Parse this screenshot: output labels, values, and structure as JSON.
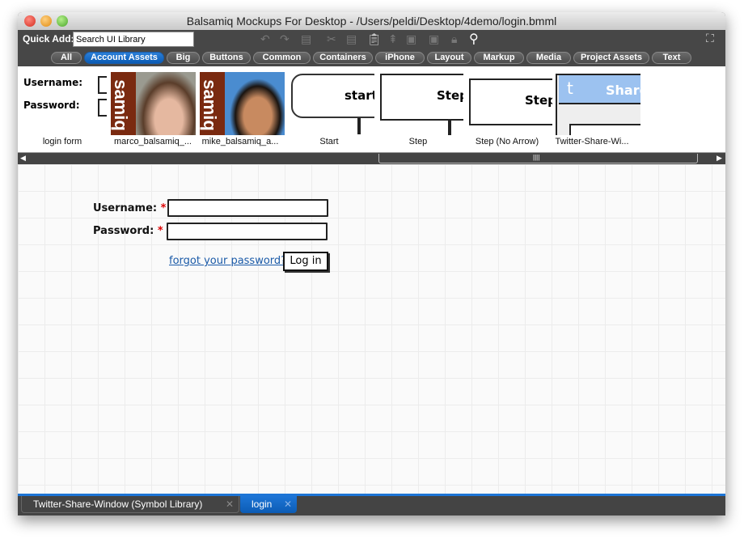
{
  "window": {
    "title": "Balsamiq Mockups For Desktop - /Users/peldi/Desktop/4demo/login.bmml"
  },
  "toolbar": {
    "quick_add_label": "Quick Add:",
    "search_value": "Search UI Library",
    "icons": [
      "undo-icon",
      "redo-icon",
      "duplicate-icon",
      "cut-icon",
      "copy-icon",
      "paste-icon",
      "group-icon",
      "bring-forward-icon",
      "send-backward-icon",
      "lock-icon",
      "search-icon"
    ],
    "fullscreen_icon": "fullscreen-icon"
  },
  "filters": [
    {
      "label": "All"
    },
    {
      "label": "Account Assets",
      "active": true
    },
    {
      "label": "Big"
    },
    {
      "label": "Buttons"
    },
    {
      "label": "Common"
    },
    {
      "label": "Containers"
    },
    {
      "label": "iPhone"
    },
    {
      "label": "Layout"
    },
    {
      "label": "Markup"
    },
    {
      "label": "Media"
    },
    {
      "label": "Project Assets"
    },
    {
      "label": "Text"
    }
  ],
  "library": {
    "items": [
      {
        "label": "login form",
        "preview_username": "Username:",
        "preview_password": "Password:"
      },
      {
        "label": "marco_balsamiq_...",
        "logo_text": "samiq"
      },
      {
        "label": "mike_balsamiq_a...",
        "logo_text": "samiq"
      },
      {
        "label": "Start",
        "preview_text": "start"
      },
      {
        "label": "Step",
        "preview_text": "Step"
      },
      {
        "label": "Step (No Arrow)",
        "preview_text": "Step"
      },
      {
        "label": "Twitter-Share-Wi...",
        "preview_text": "Share"
      }
    ]
  },
  "mockup": {
    "username_label": "Username:",
    "password_label": "Password:",
    "required_mark": "*",
    "username_value": "",
    "password_value": "",
    "forgot_link": "forgot your password?",
    "login_button": "Log in"
  },
  "tabs": [
    {
      "label": "Twitter-Share-Window (Symbol Library)",
      "active": false
    },
    {
      "label": "login",
      "active": true
    }
  ],
  "colors": {
    "accent": "#1d75d6",
    "link": "#1a5aa8",
    "required": "#dd0000",
    "logo_brown": "#7a2a10"
  }
}
